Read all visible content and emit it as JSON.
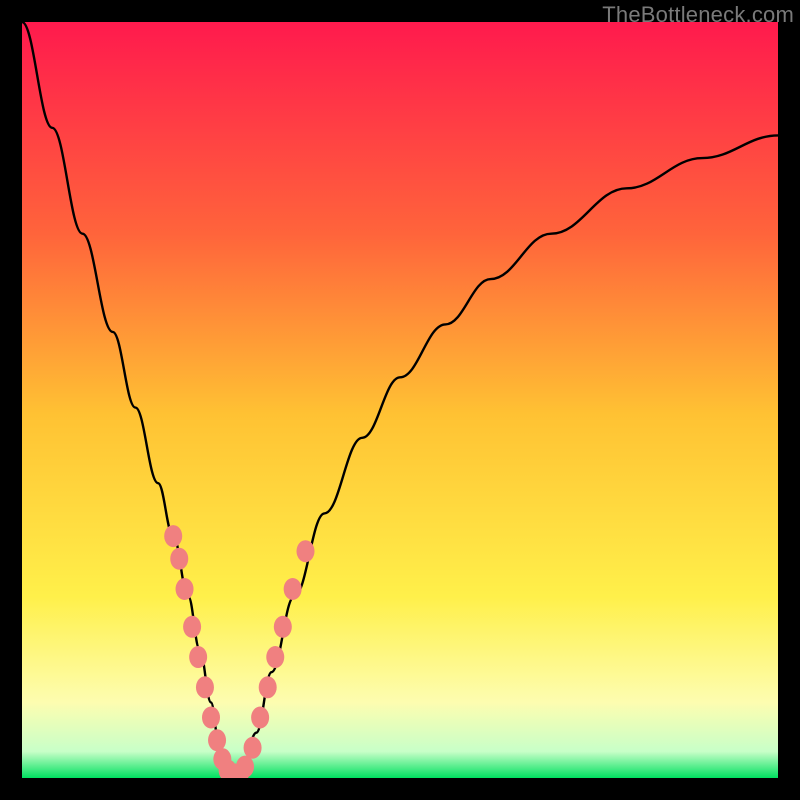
{
  "watermark": "TheBottleneck.com",
  "chart_data": {
    "type": "line",
    "title": "",
    "xlabel": "",
    "ylabel": "",
    "xlim": [
      0,
      100
    ],
    "ylim": [
      0,
      100
    ],
    "background": {
      "type": "vertical-gradient",
      "stops": [
        {
          "pos": 0.0,
          "color": "#ff1a4d"
        },
        {
          "pos": 0.28,
          "color": "#ff643b"
        },
        {
          "pos": 0.52,
          "color": "#ffc233"
        },
        {
          "pos": 0.76,
          "color": "#fff04a"
        },
        {
          "pos": 0.9,
          "color": "#fdfdb0"
        },
        {
          "pos": 0.965,
          "color": "#c8ffc8"
        },
        {
          "pos": 1.0,
          "color": "#00e060"
        }
      ]
    },
    "series": [
      {
        "name": "bottleneck-curve",
        "color": "#000000",
        "x": [
          0,
          4,
          8,
          12,
          15,
          18,
          20,
          22,
          23.5,
          25,
          26,
          27,
          28,
          29,
          31,
          33,
          36,
          40,
          45,
          50,
          56,
          62,
          70,
          80,
          90,
          100
        ],
        "y": [
          100,
          86,
          72,
          59,
          49,
          39,
          32,
          24,
          17,
          10,
          5,
          1,
          0,
          1,
          6,
          14,
          24,
          35,
          45,
          53,
          60,
          66,
          72,
          78,
          82,
          85
        ]
      }
    ],
    "markers": {
      "name": "highlight-points",
      "color": "#f08080",
      "points": [
        {
          "x": 20.0,
          "y": 32
        },
        {
          "x": 20.8,
          "y": 29
        },
        {
          "x": 21.5,
          "y": 25
        },
        {
          "x": 22.5,
          "y": 20
        },
        {
          "x": 23.3,
          "y": 16
        },
        {
          "x": 24.2,
          "y": 12
        },
        {
          "x": 25.0,
          "y": 8
        },
        {
          "x": 25.8,
          "y": 5
        },
        {
          "x": 26.5,
          "y": 2.5
        },
        {
          "x": 27.2,
          "y": 1
        },
        {
          "x": 28.0,
          "y": 0.5
        },
        {
          "x": 28.8,
          "y": 0.5
        },
        {
          "x": 29.5,
          "y": 1.5
        },
        {
          "x": 30.5,
          "y": 4
        },
        {
          "x": 31.5,
          "y": 8
        },
        {
          "x": 32.5,
          "y": 12
        },
        {
          "x": 33.5,
          "y": 16
        },
        {
          "x": 34.5,
          "y": 20
        },
        {
          "x": 35.8,
          "y": 25
        },
        {
          "x": 37.5,
          "y": 30
        }
      ]
    }
  }
}
